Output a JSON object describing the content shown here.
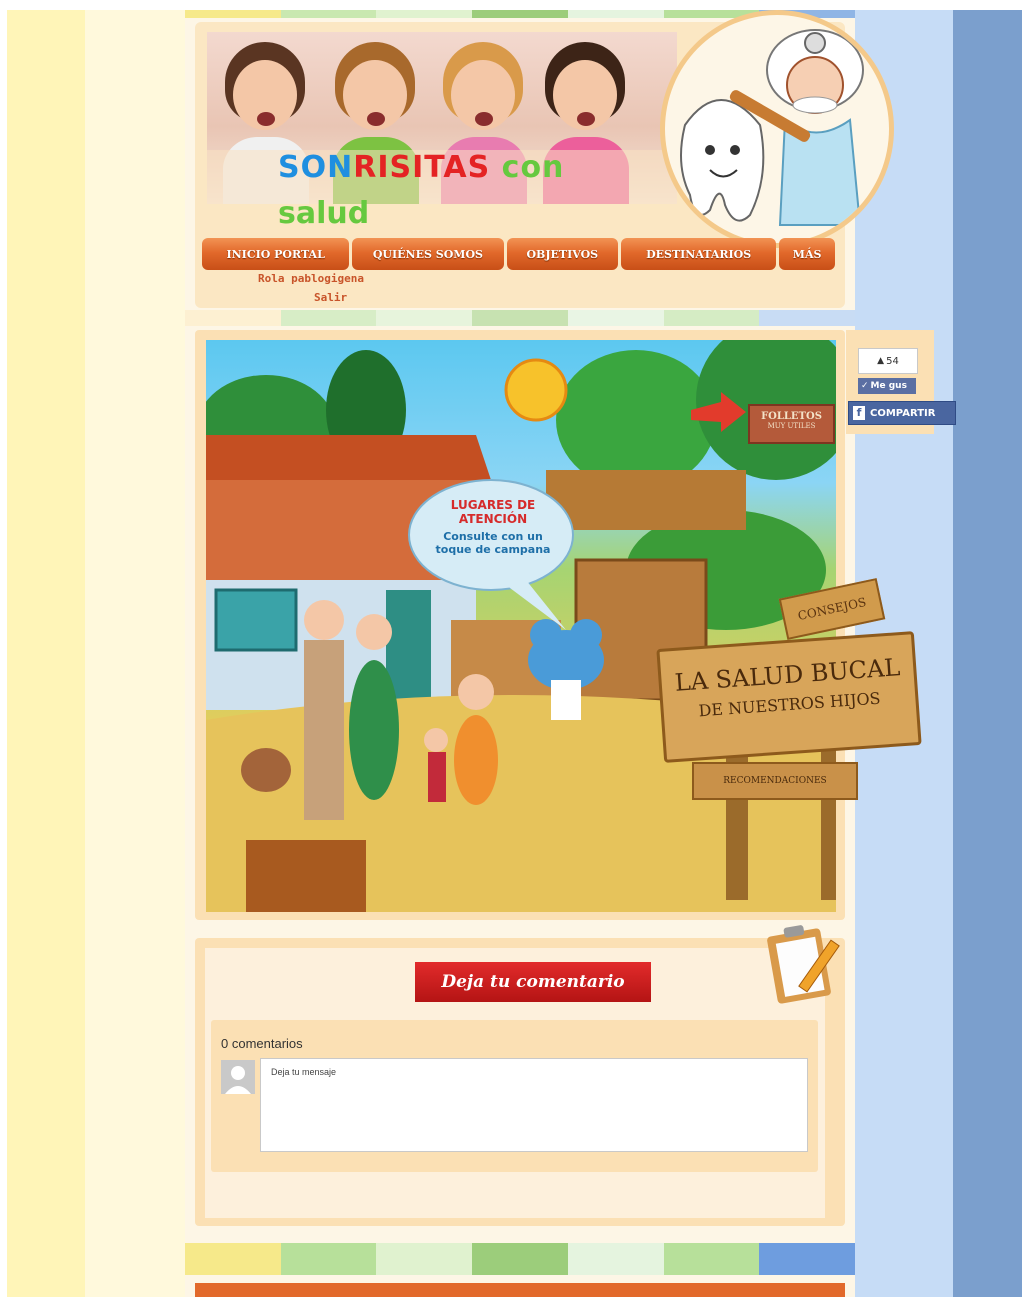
{
  "header": {
    "title_parts": [
      {
        "text": "SON",
        "color": "#1f8fe0"
      },
      {
        "text": "RISITAS",
        "color": "#e42323"
      },
      {
        "text": " con",
        "color": "#66c93f"
      }
    ],
    "title_line2": "salud"
  },
  "nav": {
    "items": [
      {
        "label": "INICIO PORTAL"
      },
      {
        "label": "QUIÉNES SOMOS"
      },
      {
        "label": "OBJETIVOS"
      },
      {
        "label": "DESTINATARIOS"
      },
      {
        "label": "MÁS"
      }
    ],
    "subitems": [
      {
        "label": "Rola pablogigena"
      },
      {
        "label": "Salir"
      }
    ]
  },
  "scene": {
    "bubble_title": "LUGARES DE ATENCIÓN",
    "bubble_body": "Consulte con un toque de campana",
    "sign_folletos": "FOLLETOS",
    "sign_folletos_sub": "MUY UTILES",
    "sign_consejos": "CONSEJOS",
    "sign_main_1": "LA SALUD BUCAL",
    "sign_main_2": "DE NUESTROS HIJOS",
    "sign_recomendaciones": "RECOMENDACIONES"
  },
  "social": {
    "like_count": "54",
    "me_gusta": "Me gus",
    "share_label": "COMPARTIR",
    "share_icon": "facebook-icon"
  },
  "comments": {
    "button_label": "Deja tu comentario",
    "count_label": "0 comentarios",
    "placeholder": "Deja tu mensaje"
  },
  "colors": {
    "nav_orange": "#e2692b",
    "panel_bg": "#fbe0b4",
    "facebook_blue": "#4a66a0"
  }
}
